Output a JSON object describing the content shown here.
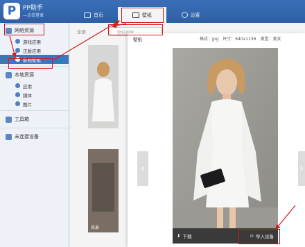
{
  "app": {
    "title": "PP助手",
    "subtitle": "—点击登录",
    "logo_letter": "P"
  },
  "topnav": {
    "tabs": [
      {
        "label": "首页"
      },
      {
        "label": "壁纸"
      },
      {
        "label": "设置"
      }
    ]
  },
  "sidebar": {
    "groups": [
      {
        "label": "网络资源",
        "items": [
          {
            "label": "游戏应用"
          },
          {
            "label": "正版应用"
          },
          {
            "label": "影视壁纸"
          }
        ]
      },
      {
        "label": "本地资源",
        "items": [
          {
            "label": "应用"
          },
          {
            "label": "媒体"
          },
          {
            "label": "图片"
          }
        ]
      },
      {
        "label": "工具箱"
      },
      {
        "label": "未连接设备"
      }
    ]
  },
  "main": {
    "breadcrumb": "全部",
    "search_placeholder": "壁纸搜索",
    "thumb2_label": "风景"
  },
  "preview": {
    "title": "壁纸",
    "format": "格式：jpg",
    "size": "尺寸：640x1136",
    "type": "类型：美女",
    "download_label": "下载",
    "import_label": "导入设备"
  },
  "colors": {
    "accent": "#3f73bd",
    "header": "#2e5fa3",
    "annotation": "#d01a1a"
  }
}
